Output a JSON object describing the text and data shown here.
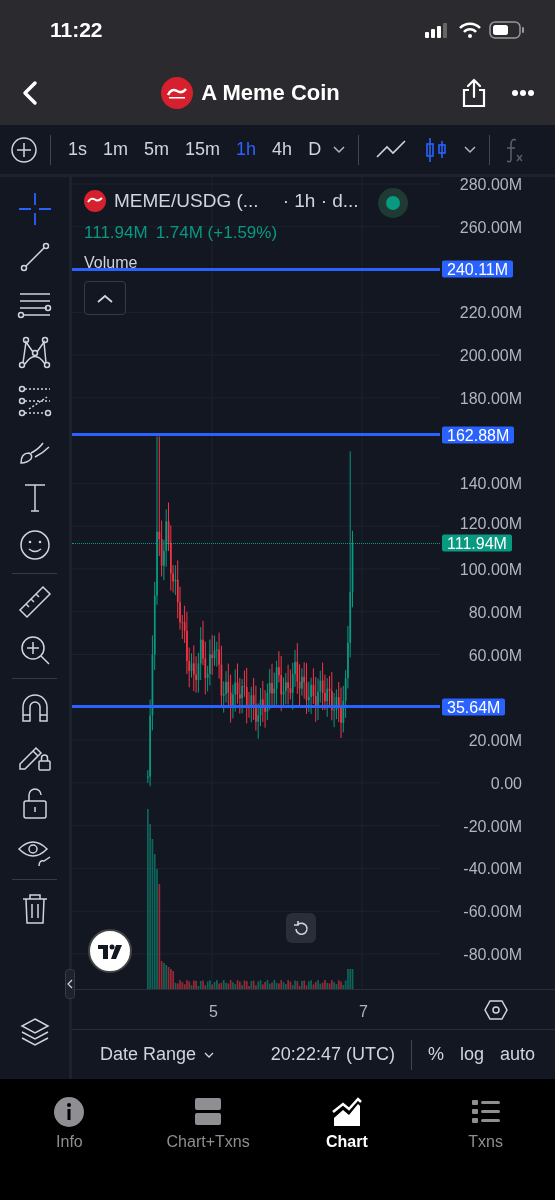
{
  "status_bar": {
    "time": "11:22"
  },
  "header": {
    "title": "A Meme Coin"
  },
  "toolbar": {
    "intervals": [
      {
        "label": "1s",
        "selected": false
      },
      {
        "label": "1m",
        "selected": false
      },
      {
        "label": "5m",
        "selected": false
      },
      {
        "label": "15m",
        "selected": false
      },
      {
        "label": "1h",
        "selected": true
      },
      {
        "label": "4h",
        "selected": false
      },
      {
        "label": "D",
        "selected": false
      }
    ],
    "chart_types": [
      {
        "kind": "line",
        "selected": false
      },
      {
        "kind": "candles",
        "selected": true
      }
    ]
  },
  "legend": {
    "symbol": "MEME/USDG (...",
    "interval": "· 1h · d...",
    "price": "111.94M",
    "change": "1.74M (+1.59%)",
    "indicator": "Volume"
  },
  "price_axis": [
    "280.00M",
    "260.00M",
    "220.00M",
    "200.00M",
    "180.00M",
    "140.00M",
    "120.00M",
    "100.00M",
    "80.00M",
    "60.00M",
    "20.00M",
    "0.00",
    "-20.00M",
    "-40.00M",
    "-60.00M",
    "-80.00M"
  ],
  "price_lines": [
    {
      "label": "240.11M",
      "color": "#2962ff",
      "kind": "solid"
    },
    {
      "label": "162.88M",
      "color": "#2962ff",
      "kind": "solid"
    },
    {
      "label": "111.94M",
      "color": "#089981",
      "kind": "dotted"
    },
    {
      "label": "35.64M",
      "color": "#2962ff",
      "kind": "solid"
    }
  ],
  "time_axis": [
    "5",
    "7"
  ],
  "bottom_bar": {
    "range": "Date Range",
    "clock": "20:22:47 (UTC)",
    "options": [
      "%",
      "log",
      "auto"
    ]
  },
  "tabs": [
    {
      "label": "Info",
      "selected": false
    },
    {
      "label": "Chart+Txns",
      "selected": false
    },
    {
      "label": "Chart",
      "selected": true
    },
    {
      "label": "Txns",
      "selected": false
    }
  ]
}
